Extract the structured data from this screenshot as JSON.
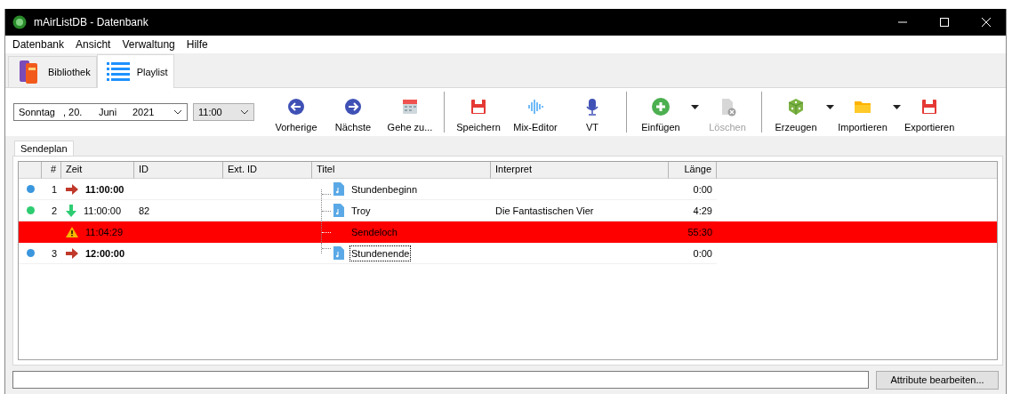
{
  "window": {
    "title": "mAirListDB - Datenbank"
  },
  "menu": [
    "Datenbank",
    "Ansicht",
    "Verwaltung",
    "Hilfe"
  ],
  "tabs": [
    {
      "label": "Bibliothek",
      "selected": false
    },
    {
      "label": "Playlist",
      "selected": true
    }
  ],
  "date": {
    "weekday": "Sonntag",
    "day": ", 20.",
    "month": "Juni",
    "year": "2021"
  },
  "time": "11:00",
  "toolbar": [
    [
      {
        "label": "Vorherige",
        "disabled": false,
        "dropdown": false
      },
      {
        "label": "Nächste",
        "disabled": false,
        "dropdown": false
      },
      {
        "label": "Gehe zu...",
        "disabled": false,
        "dropdown": false
      }
    ],
    [
      {
        "label": "Speichern",
        "disabled": false,
        "dropdown": false
      },
      {
        "label": "Mix-Editor",
        "disabled": false,
        "dropdown": false
      },
      {
        "label": "VT",
        "disabled": false,
        "dropdown": false
      }
    ],
    [
      {
        "label": "Einfügen",
        "disabled": false,
        "dropdown": true
      },
      {
        "label": "Löschen",
        "disabled": true,
        "dropdown": false
      }
    ],
    [
      {
        "label": "Erzeugen",
        "disabled": false,
        "dropdown": true
      },
      {
        "label": "Importieren",
        "disabled": false,
        "dropdown": true
      },
      {
        "label": "Exportieren",
        "disabled": false,
        "dropdown": false
      }
    ]
  ],
  "subtab": {
    "label": "Sendeplan",
    "selected": true
  },
  "table": {
    "columns": [
      "#",
      "Zeit",
      "ID",
      "Ext. ID",
      "Titel",
      "Interpret",
      "Länge"
    ],
    "rows": [
      {
        "kind": "hour",
        "color": "#3a96dd",
        "number": "1",
        "time": "11:00:00",
        "id": "",
        "title": "Stundenbeginn",
        "interpret": "",
        "length": "0:00",
        "focused": false
      },
      {
        "kind": "song",
        "color": "#2ecc71",
        "number": "2",
        "time": "11:00:00",
        "id": "82",
        "title": "Troy",
        "interpret": "Die Fantastischen Vier",
        "length": "4:29",
        "focused": false
      },
      {
        "kind": "gap",
        "time": "11:04:29",
        "id": "",
        "title": "Sendeloch",
        "interpret": "",
        "length": "55:30",
        "focused": false
      },
      {
        "kind": "hour",
        "color": "#3a96dd",
        "number": "3",
        "time": "12:00:00",
        "id": "",
        "title": "Stundenende",
        "interpret": "",
        "length": "0:00",
        "focused": true
      }
    ]
  },
  "attribute_button": "Attribute bearbeiten..."
}
